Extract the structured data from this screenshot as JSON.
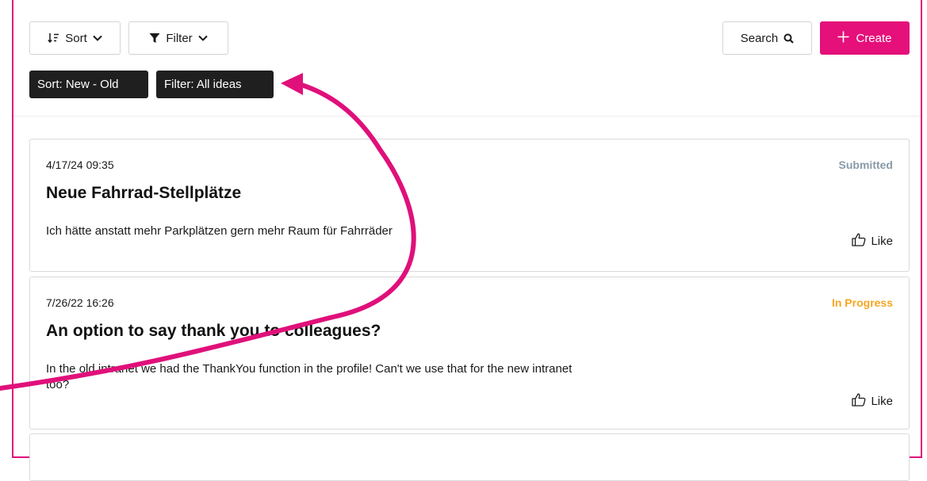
{
  "toolbar": {
    "sort_label": "Sort",
    "filter_label": "Filter",
    "search_label": "Search",
    "create_label": "Create"
  },
  "chips": {
    "sort": "Sort: New - Old",
    "filter": "Filter: All ideas"
  },
  "ideas": [
    {
      "date": "4/17/24 09:35",
      "status": "Submitted",
      "status_color": "#8a9ba8",
      "title": "Neue Fahrrad-Stellplätze",
      "text": "Ich hätte anstatt mehr Parkplätzen gern mehr Raum für Fahrräder",
      "like_label": "Like"
    },
    {
      "date": "7/26/22 16:26",
      "status": "In Progress",
      "status_color": "#f5a623",
      "title": "An option to say thank you to colleagues?",
      "text": "In the old intranet we had the ThankYou function in the profile! Can't we use that for the new intranet too?",
      "like_label": "Like"
    }
  ],
  "colors": {
    "accent": "#e5107a",
    "chip_bg": "#1f1f1f",
    "annotation_arrow": "#e0107a"
  },
  "icons": {
    "sort": "sort-descending-icon",
    "filter": "funnel-icon",
    "chevron": "chevron-down-icon",
    "search": "magnifier-icon",
    "create": "plus-icon",
    "like": "thumbs-up-icon"
  }
}
